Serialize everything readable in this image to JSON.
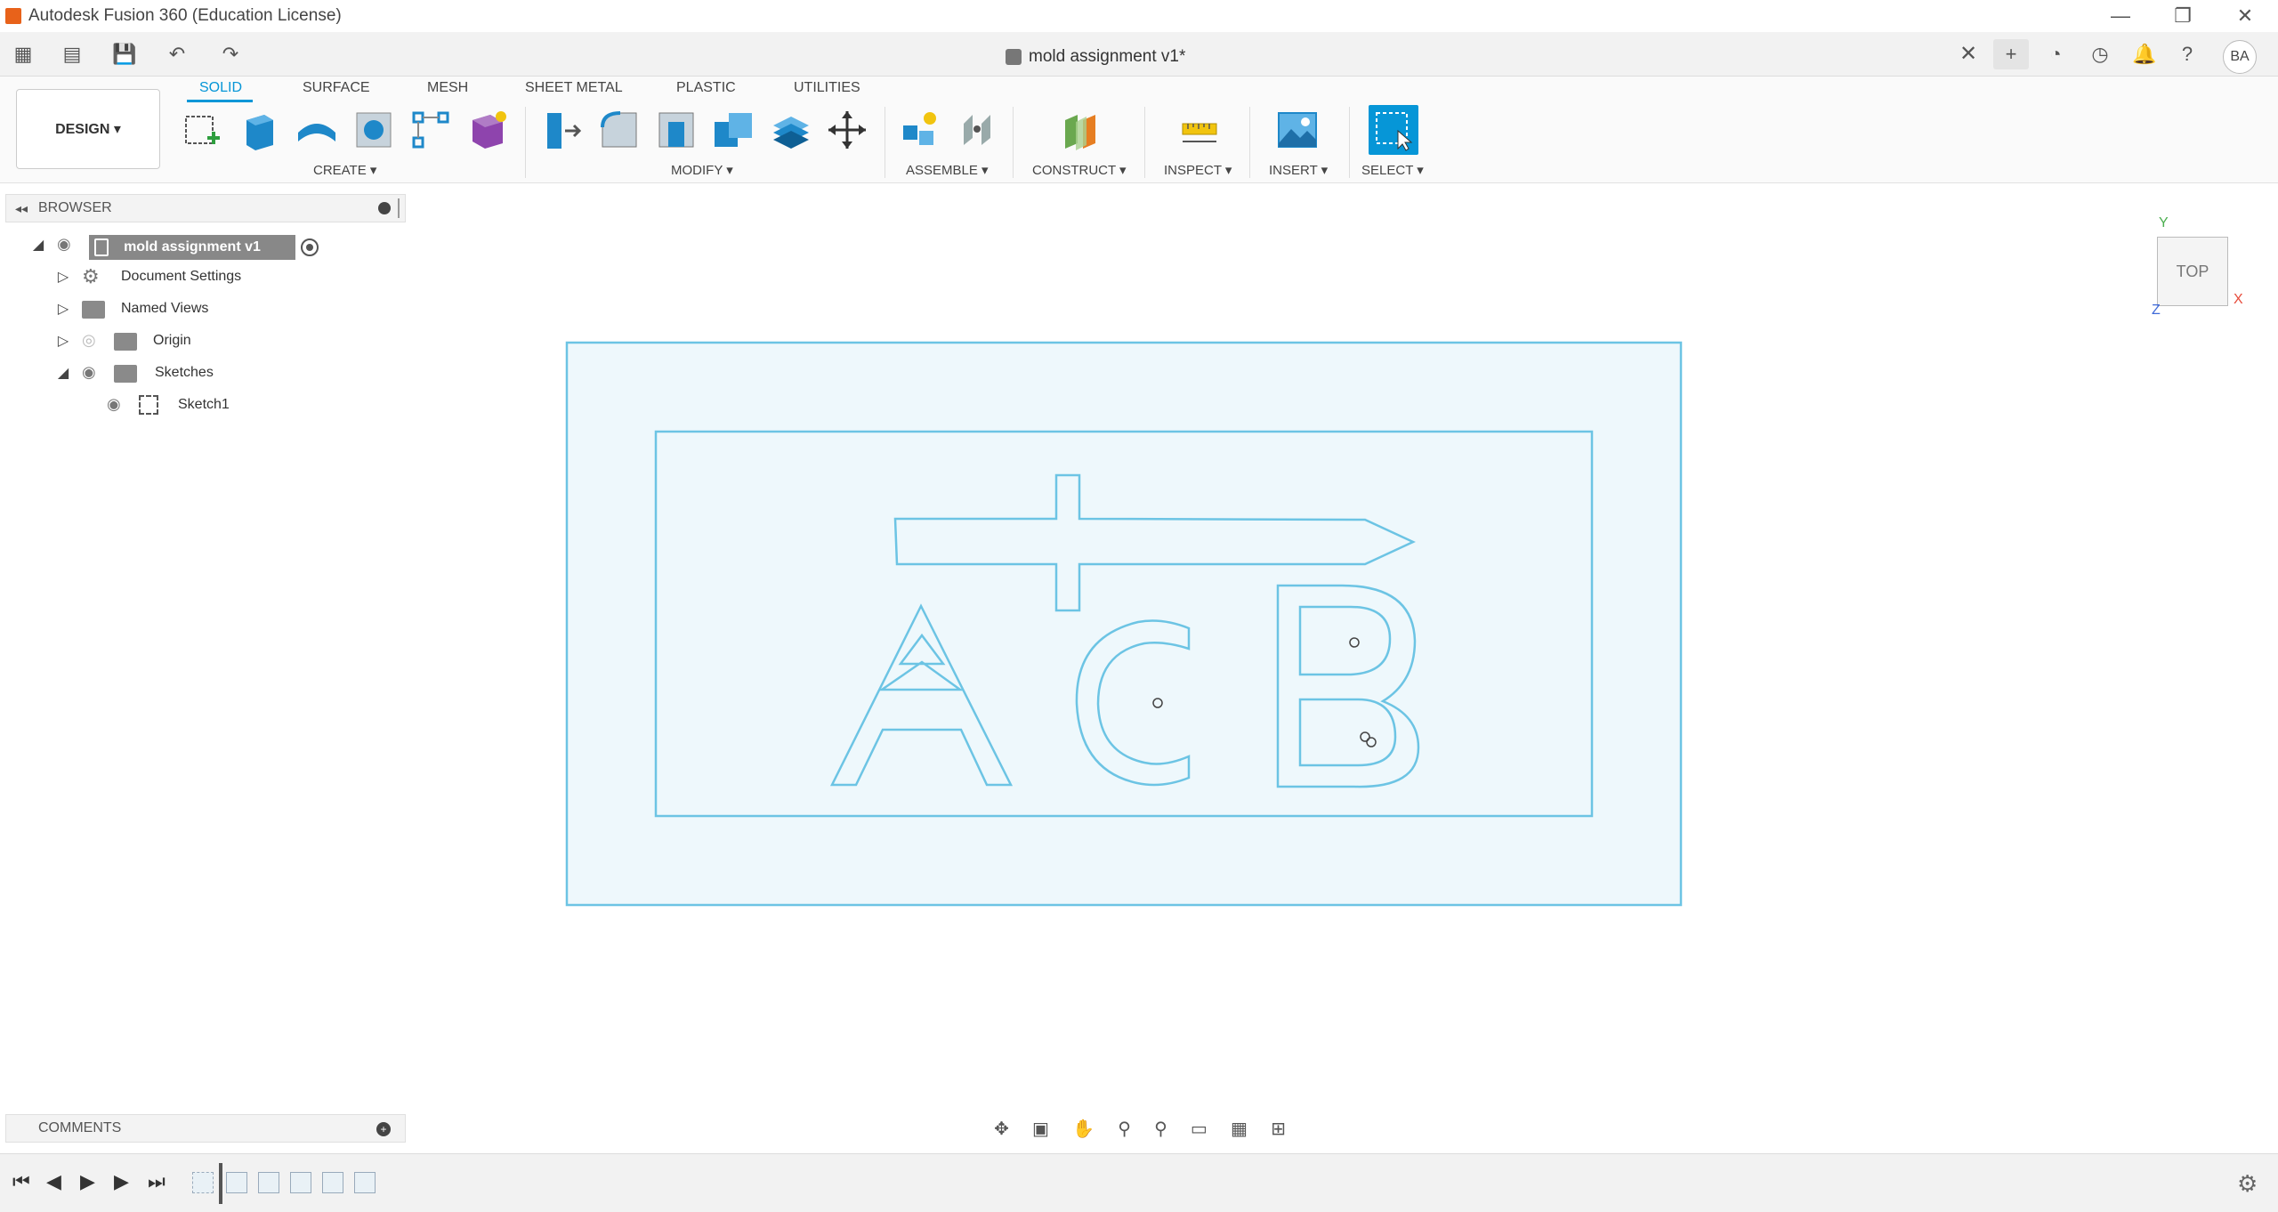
{
  "window": {
    "title": "Autodesk Fusion 360 (Education License)",
    "controls": {
      "minimize": "—",
      "restore": "❐",
      "close": "✕"
    }
  },
  "tabbar": {
    "document_title": "mold assignment v1*",
    "close_glyph": "✕",
    "user_initials": "BA",
    "quick_access": {
      "apps": "▦",
      "file": "▤",
      "save": "💾",
      "undo": "↶",
      "redo": "↷"
    },
    "right_icons": {
      "new_tab": "+",
      "extensions": "◔",
      "job_status": "◷",
      "notifications": "🔔",
      "help": "?"
    }
  },
  "toolbar": {
    "workspace": "DESIGN ▾",
    "tabs": [
      "SOLID",
      "SURFACE",
      "MESH",
      "SHEET METAL",
      "PLASTIC",
      "UTILITIES"
    ],
    "active_tab": "SOLID",
    "groups": {
      "create": "CREATE ▾",
      "modify": "MODIFY ▾",
      "assemble": "ASSEMBLE ▾",
      "construct": "CONSTRUCT ▾",
      "inspect": "INSPECT ▾",
      "insert": "INSERT ▾",
      "select": "SELECT ▾"
    },
    "colors": {
      "accent": "#0696d7",
      "create_blue": "#1e88c9",
      "form_purple": "#8e44ad",
      "construct_green": "#6aa84f",
      "construct_orange": "#e67e22"
    }
  },
  "browser": {
    "title": "BROWSER",
    "root": "mold assignment v1",
    "items": [
      {
        "label": "Document Settings"
      },
      {
        "label": "Named Views"
      },
      {
        "label": "Origin"
      },
      {
        "label": "Sketches"
      },
      {
        "label": "Sketch1"
      }
    ]
  },
  "comments": {
    "title": "COMMENTS"
  },
  "viewcube": {
    "face": "TOP",
    "axis_y": "Y",
    "axis_x": "X",
    "axis_z": "Z"
  },
  "navbar": {
    "orbit": "✥",
    "look": "▣",
    "pan": "✋",
    "zoom": "⚲",
    "fit": "⚲",
    "display": "▭",
    "grid": "▦",
    "viewports": "⊞"
  },
  "sketch": {
    "stroke_color": "#6cc4e4",
    "fill_color": "#eef8fc"
  },
  "timeline": {
    "first": "⏮",
    "prev": "◀",
    "play": "▶",
    "next": "▶",
    "last": "⏭",
    "settings": "⚙"
  }
}
